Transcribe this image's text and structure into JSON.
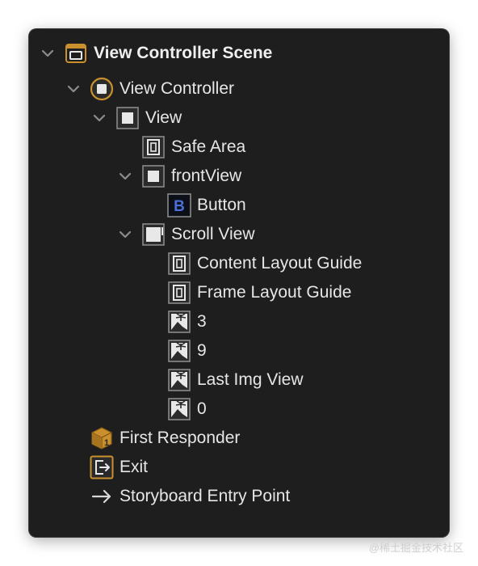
{
  "tree": [
    {
      "label": "View Controller Scene",
      "icon": "scene-icon",
      "expanded": true
    },
    {
      "label": "View Controller",
      "icon": "view-controller-icon",
      "expanded": true
    },
    {
      "label": "View",
      "icon": "view-icon",
      "expanded": true
    },
    {
      "label": "Safe Area",
      "icon": "safe-area-icon"
    },
    {
      "label": "frontView",
      "icon": "view-icon",
      "expanded": true
    },
    {
      "label": "Button",
      "icon": "button-icon",
      "glyph": "B"
    },
    {
      "label": "Scroll View",
      "icon": "scroll-view-icon",
      "expanded": true
    },
    {
      "label": "Content Layout Guide",
      "icon": "layout-guide-icon"
    },
    {
      "label": "Frame Layout Guide",
      "icon": "layout-guide-icon"
    },
    {
      "label": "3",
      "icon": "image-view-icon"
    },
    {
      "label": "9",
      "icon": "image-view-icon"
    },
    {
      "label": "Last Img View",
      "icon": "image-view-icon"
    },
    {
      "label": "0",
      "icon": "image-view-icon"
    },
    {
      "label": "First Responder",
      "icon": "first-responder-icon",
      "glyph": "1"
    },
    {
      "label": "Exit",
      "icon": "exit-icon"
    },
    {
      "label": "Storyboard Entry Point",
      "icon": "arrow-right-icon"
    }
  ],
  "watermark": "@稀土掘金技术社区",
  "colors": {
    "panel_bg": "#1e1e1e",
    "text": "#e6e6e6",
    "icon_gray": "#8a8a8a",
    "orange": "#c9902d",
    "button_blue": "#4a6fd6"
  }
}
